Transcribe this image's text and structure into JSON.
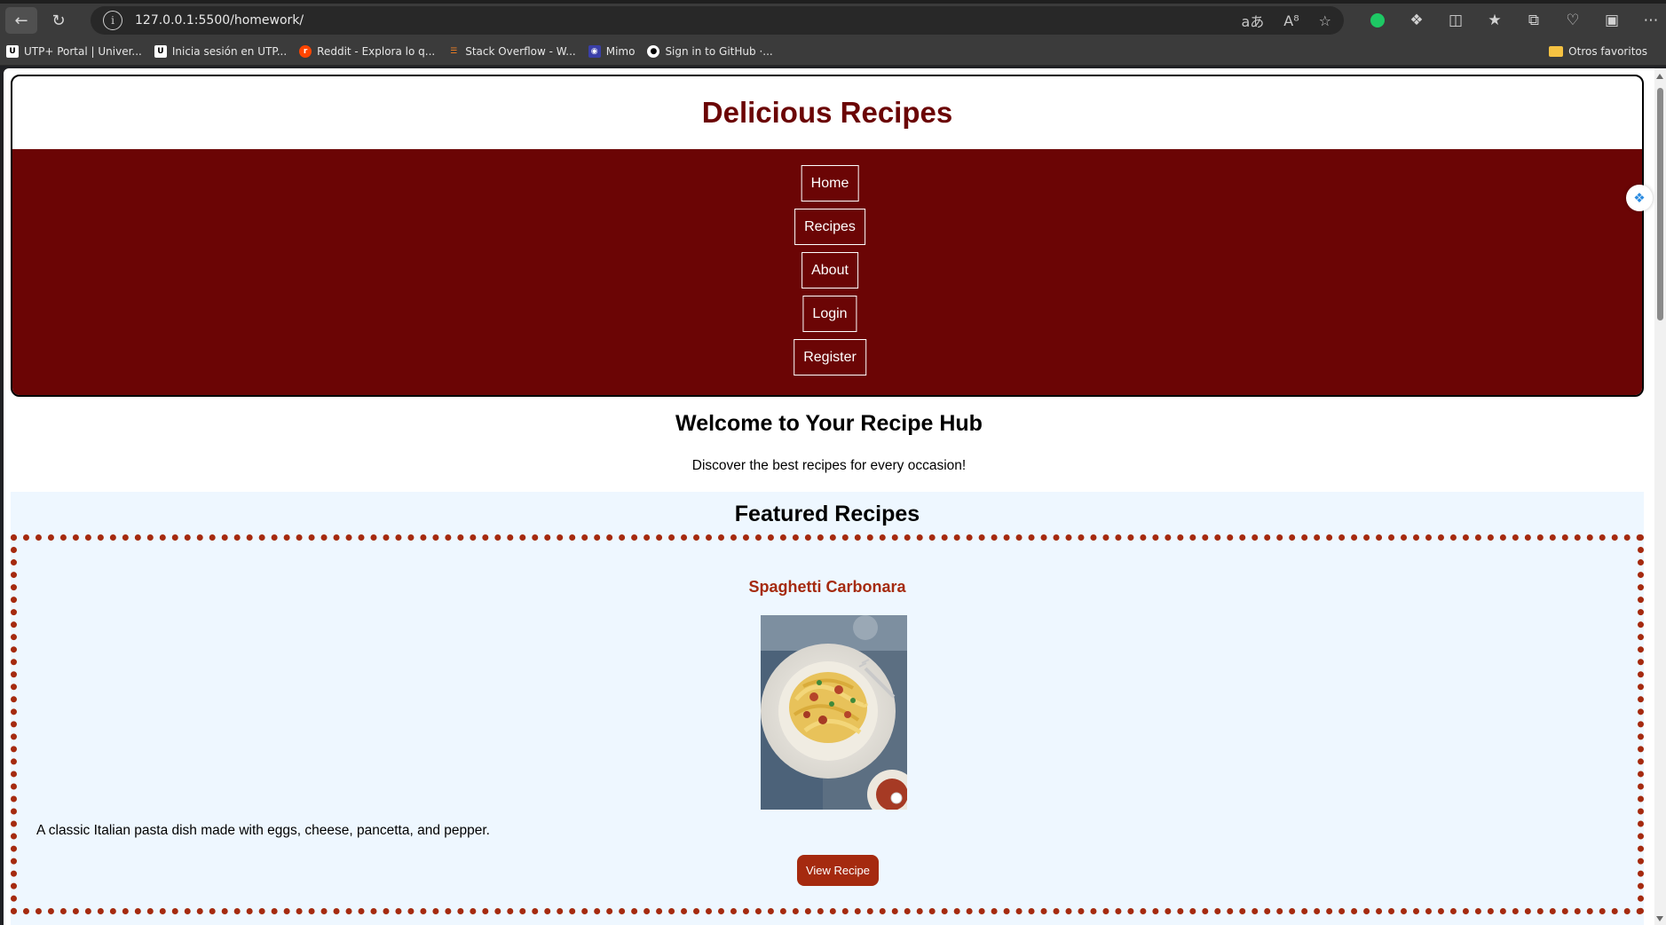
{
  "browser": {
    "url": "127.0.0.1:5500/homework/",
    "bookmarks": [
      {
        "label": "UTP+ Portal | Univer...",
        "icon": "utp-icon"
      },
      {
        "label": "Inicia sesión en UTP...",
        "icon": "utp-icon"
      },
      {
        "label": "Reddit - Explora lo q...",
        "icon": "reddit-icon"
      },
      {
        "label": "Stack Overflow - W...",
        "icon": "stackoverflow-icon"
      },
      {
        "label": "Mimo",
        "icon": "mimo-icon"
      },
      {
        "label": "Sign in to GitHub ·...",
        "icon": "github-icon"
      }
    ],
    "other_favorites": "Otros favoritos"
  },
  "header": {
    "title": "Delicious Recipes",
    "nav": [
      "Home",
      "Recipes",
      "About",
      "Login",
      "Register"
    ]
  },
  "welcome": {
    "title": "Welcome to Your Recipe Hub",
    "subtitle": "Discover the best recipes for every occasion!"
  },
  "featured": {
    "title": "Featured Recipes",
    "recipe": {
      "name": "Spaghetti Carbonara",
      "description": "A classic Italian pasta dish made with eggs, cheese, pancetta, and pepper.",
      "button": "View Recipe"
    }
  },
  "colors": {
    "brand": "#6b0505",
    "accent": "#a52a0f",
    "featured_bg": "#eef7ff"
  }
}
